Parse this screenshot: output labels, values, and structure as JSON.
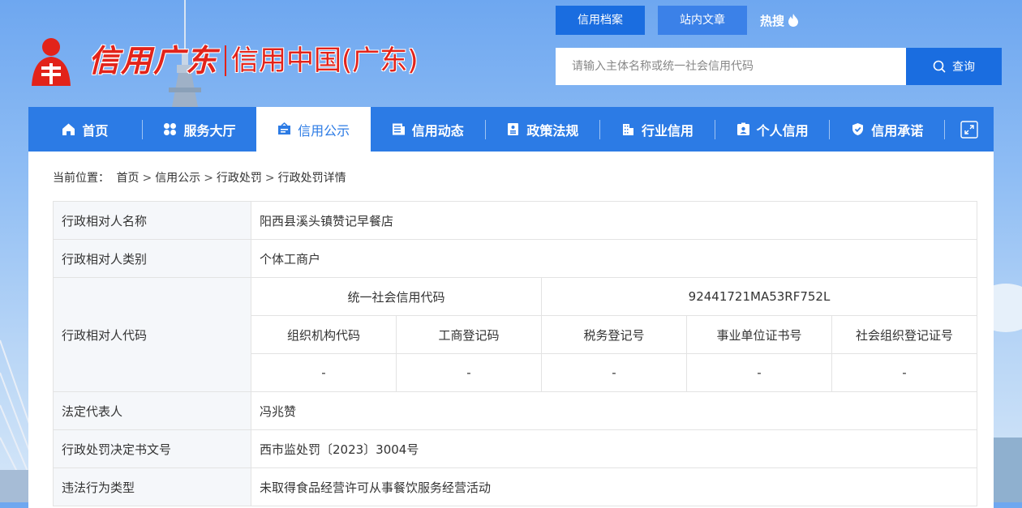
{
  "logo": {
    "calligraphy": "信用广东",
    "subtitle": "信用中国(广东)"
  },
  "search": {
    "tabs": [
      "信用档案",
      "站内文章"
    ],
    "hot_label": "热搜",
    "placeholder": "请输入主体名称或统一社会信用代码",
    "button_label": "查询"
  },
  "nav": {
    "items": [
      {
        "label": "首页",
        "icon": "home-icon"
      },
      {
        "label": "服务大厅",
        "icon": "grid-icon"
      },
      {
        "label": "信用公示",
        "icon": "notice-icon"
      },
      {
        "label": "信用动态",
        "icon": "news-icon"
      },
      {
        "label": "政策法规",
        "icon": "document-icon"
      },
      {
        "label": "行业信用",
        "icon": "building-icon"
      },
      {
        "label": "个人信用",
        "icon": "id-card-icon"
      },
      {
        "label": "信用承诺",
        "icon": "shield-check-icon"
      }
    ],
    "active_index": 2
  },
  "breadcrumb": {
    "prefix": "当前位置：",
    "items": [
      "首页",
      "信用公示",
      "行政处罚",
      "行政处罚详情"
    ],
    "separator": ">"
  },
  "detail": {
    "name_label": "行政相对人名称",
    "name_value": "阳西县溪头镇赞记早餐店",
    "category_label": "行政相对人类别",
    "category_value": "个体工商户",
    "code_label": "行政相对人代码",
    "uscc_label": "统一社会信用代码",
    "uscc_value": "92441721MA53RF752L",
    "sub_headers": [
      "组织机构代码",
      "工商登记码",
      "税务登记号",
      "事业单位证书号",
      "社会组织登记证号"
    ],
    "sub_values": [
      "-",
      "-",
      "-",
      "-",
      "-"
    ],
    "legal_rep_label": "法定代表人",
    "legal_rep_value": "冯兆赞",
    "decision_no_label": "行政处罚决定书文号",
    "decision_no_value": "西市监处罚〔2023〕3004号",
    "violation_type_label": "违法行为类型",
    "violation_type_value": "未取得食品经营许可从事餐饮服务经营活动"
  },
  "colors": {
    "brand_red": "#e2231a",
    "nav_blue": "#2c7be5",
    "button_blue": "#1a6de0"
  }
}
